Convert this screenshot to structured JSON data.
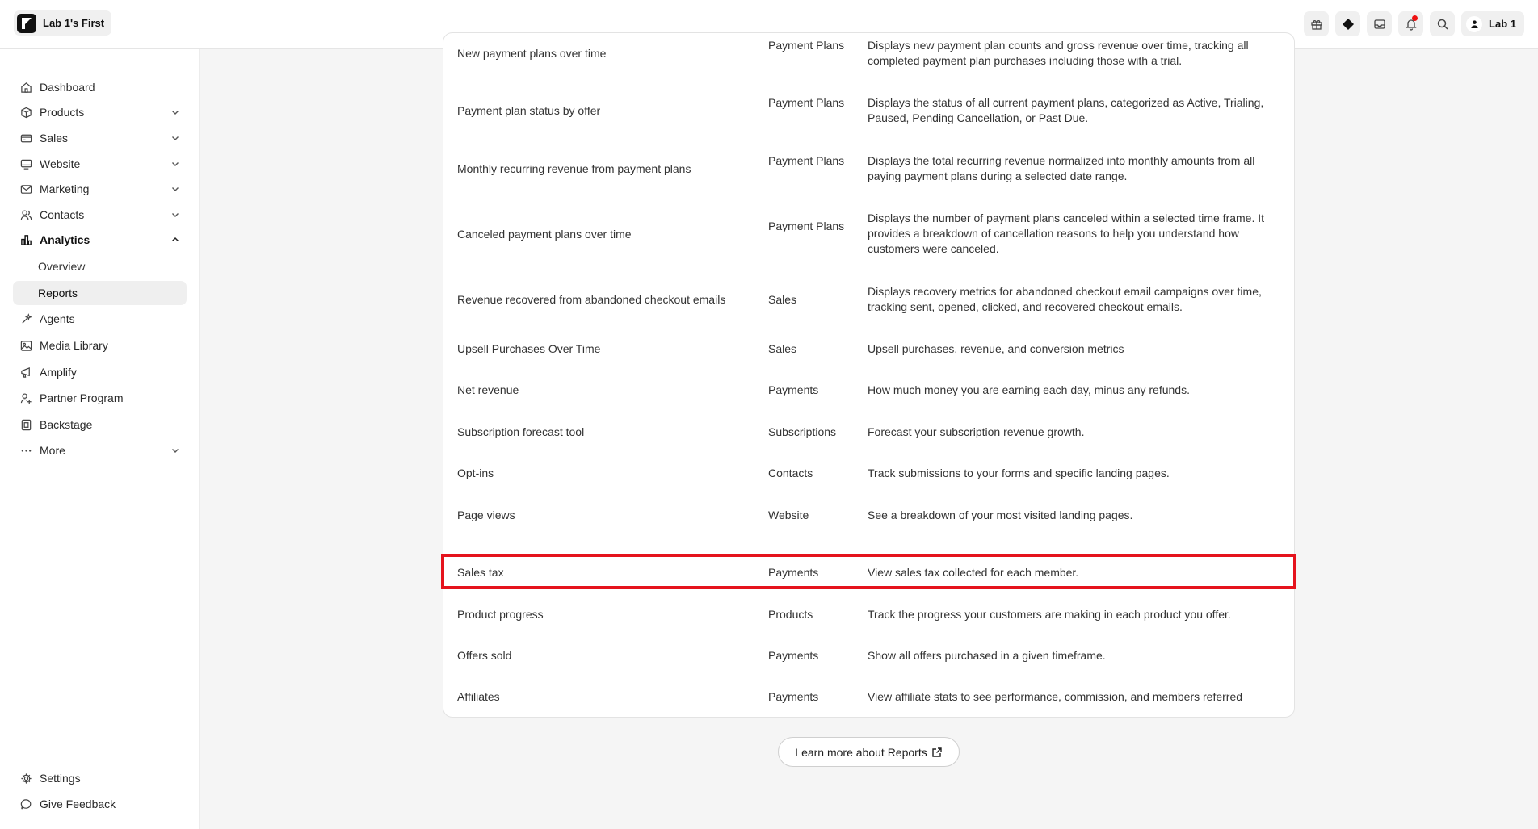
{
  "header": {
    "workspace_name": "Lab 1's First",
    "user_name": "Lab 1",
    "icons": [
      "gift-icon",
      "diamond-icon",
      "inbox-icon",
      "bell-icon",
      "search-icon"
    ]
  },
  "sidebar": {
    "items": [
      {
        "label": "Dashboard",
        "icon": "home-icon"
      },
      {
        "label": "Products",
        "icon": "box-icon"
      },
      {
        "label": "Sales",
        "icon": "card-icon"
      },
      {
        "label": "Website",
        "icon": "monitor-icon"
      },
      {
        "label": "Marketing",
        "icon": "mail-icon"
      },
      {
        "label": "Contacts",
        "icon": "users-icon"
      },
      {
        "label": "Analytics",
        "icon": "chart-icon"
      },
      {
        "label": "Agents",
        "icon": "sparkle-icon"
      },
      {
        "label": "Media Library",
        "icon": "image-icon"
      },
      {
        "label": "Amplify",
        "icon": "megaphone-icon"
      },
      {
        "label": "Partner Program",
        "icon": "partner-icon"
      },
      {
        "label": "Backstage",
        "icon": "backstage-icon"
      },
      {
        "label": "More",
        "icon": "dots-icon"
      }
    ],
    "analytics_sub": [
      {
        "label": "Overview"
      },
      {
        "label": "Reports"
      }
    ],
    "footer": [
      {
        "label": "Settings",
        "icon": "gear-icon"
      },
      {
        "label": "Give Feedback",
        "icon": "chat-icon"
      }
    ]
  },
  "reports": [
    {
      "name": "New payment plans over time",
      "category": "Payment Plans",
      "description": "Displays new payment plan counts and gross revenue over time, tracking all completed payment plan purchases including those with a trial."
    },
    {
      "name": "Payment plan status by offer",
      "category": "Payment Plans",
      "description": "Displays the status of all current payment plans, categorized as Active, Trialing, Paused, Pending Cancellation, or Past Due."
    },
    {
      "name": "Monthly recurring revenue from payment plans",
      "category": "Payment Plans",
      "description": "Displays the total recurring revenue normalized into monthly amounts from all paying payment plans during a selected date range."
    },
    {
      "name": "Canceled payment plans over time",
      "category": "Payment Plans",
      "description": "Displays the number of payment plans canceled within a selected time frame. It provides a breakdown of cancellation reasons to help you understand how customers were canceled."
    },
    {
      "name": "Revenue recovered from abandoned checkout emails",
      "category": "Sales",
      "description": "Displays recovery metrics for abandoned checkout email campaigns over time, tracking sent, opened, clicked, and recovered checkout emails."
    },
    {
      "name": "Upsell Purchases Over Time",
      "category": "Sales",
      "description": "Upsell purchases, revenue, and conversion metrics"
    },
    {
      "name": "Net revenue",
      "category": "Payments",
      "description": "How much money you are earning each day, minus any refunds."
    },
    {
      "name": "Subscription forecast tool",
      "category": "Subscriptions",
      "description": "Forecast your subscription revenue growth."
    },
    {
      "name": "Opt-ins",
      "category": "Contacts",
      "description": "Track submissions to your forms and specific landing pages."
    },
    {
      "name": "Page views",
      "category": "Website",
      "description": "See a breakdown of your most visited landing pages."
    },
    {
      "name": "Sales tax",
      "category": "Payments",
      "description": "View sales tax collected for each member."
    },
    {
      "name": "Product progress",
      "category": "Products",
      "description": "Track the progress your customers are making in each product you offer."
    },
    {
      "name": "Offers sold",
      "category": "Payments",
      "description": "Show all offers purchased in a given timeframe."
    },
    {
      "name": "Affiliates",
      "category": "Payments",
      "description": "View affiliate stats to see performance, commission, and members referred"
    }
  ],
  "learn_more_label": "Learn more about Reports",
  "highlight_color": "#e5131d"
}
